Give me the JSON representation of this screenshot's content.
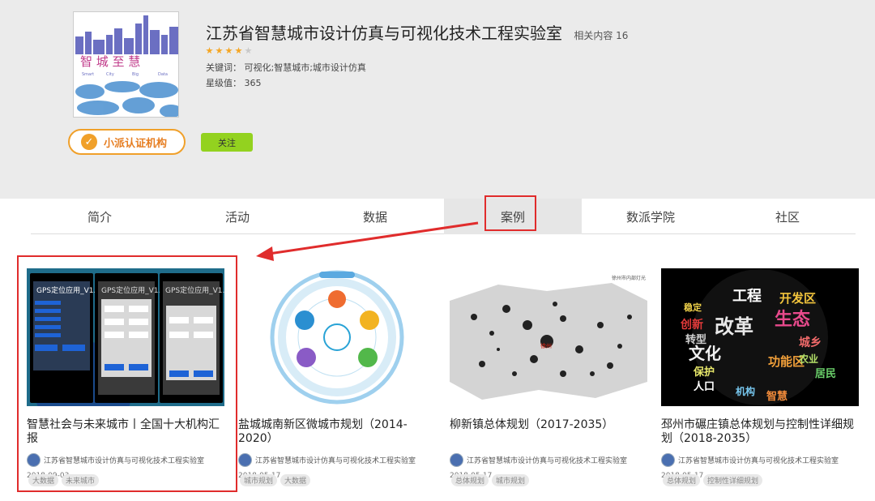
{
  "header": {
    "logo_alt": "智 城 至 慧",
    "logo_subtext": [
      "Smart",
      "City",
      "Big",
      "Data"
    ],
    "title": "江苏省智慧城市设计仿真与可视化技术工程实验室",
    "related_label": "相关内容 16",
    "rating": 4,
    "rating_max": 5,
    "keywords": "关键词： 可视化;智慧城市;城市设计仿真",
    "star_value": "星级值： 365",
    "cert_label": "小派认证机构",
    "follow_label": "关注"
  },
  "tabs": [
    {
      "label": "简介"
    },
    {
      "label": "活动"
    },
    {
      "label": "数据"
    },
    {
      "label": "案例",
      "active": true
    },
    {
      "label": "数派学院"
    },
    {
      "label": "社区"
    }
  ],
  "cards": [
    {
      "title": "智慧社会与未来城市丨全国十大机构汇报",
      "author": "江苏省智慧城市设计仿真与可视化技术工程实验室",
      "date": "2018-09-03",
      "tags": [
        "大数据",
        "未来城市"
      ],
      "thumb": "phones",
      "thumb_texts": [
        "GPS定位应用_V1.0",
        "GPS定位应用_V1.0",
        "GPS定位应用_V1.0"
      ]
    },
    {
      "title": "盐城城南新区微城市规划（2014-2020）",
      "author": "江苏省智慧城市设计仿真与可视化技术工程实验室",
      "date": "2018-05-17",
      "tags": [
        "城市规划",
        "大数据"
      ],
      "thumb": "diagram"
    },
    {
      "title": "柳新镇总体规划（2017-2035）",
      "author": "江苏省智慧城市设计仿真与可视化技术工程实验室",
      "date": "2018-05-17",
      "tags": [
        "总体规划",
        "城市规划"
      ],
      "thumb": "map",
      "thumb_texts": [
        "徐州市内部灯光",
        "徐州"
      ]
    },
    {
      "title": "邳州市碾庄镇总体规划与控制性详细规划（2018-2035）",
      "author": "江苏省智慧城市设计仿真与可视化技术工程实验室",
      "date": "2018-05-17",
      "tags": [
        "总体规划",
        "控制性详细规划"
      ],
      "thumb": "wordcloud",
      "thumb_texts": [
        "工程",
        "开发区",
        "生态",
        "改革",
        "文化",
        "创新",
        "功能区",
        "居民",
        "保护",
        "转型",
        "稳定",
        "人口",
        "机构",
        "农业",
        "智慧",
        "城乡"
      ]
    }
  ],
  "colors": {
    "accent_red": "#e02c2c",
    "cert_orange": "#f0a02a",
    "follow_green": "#93d21f"
  }
}
